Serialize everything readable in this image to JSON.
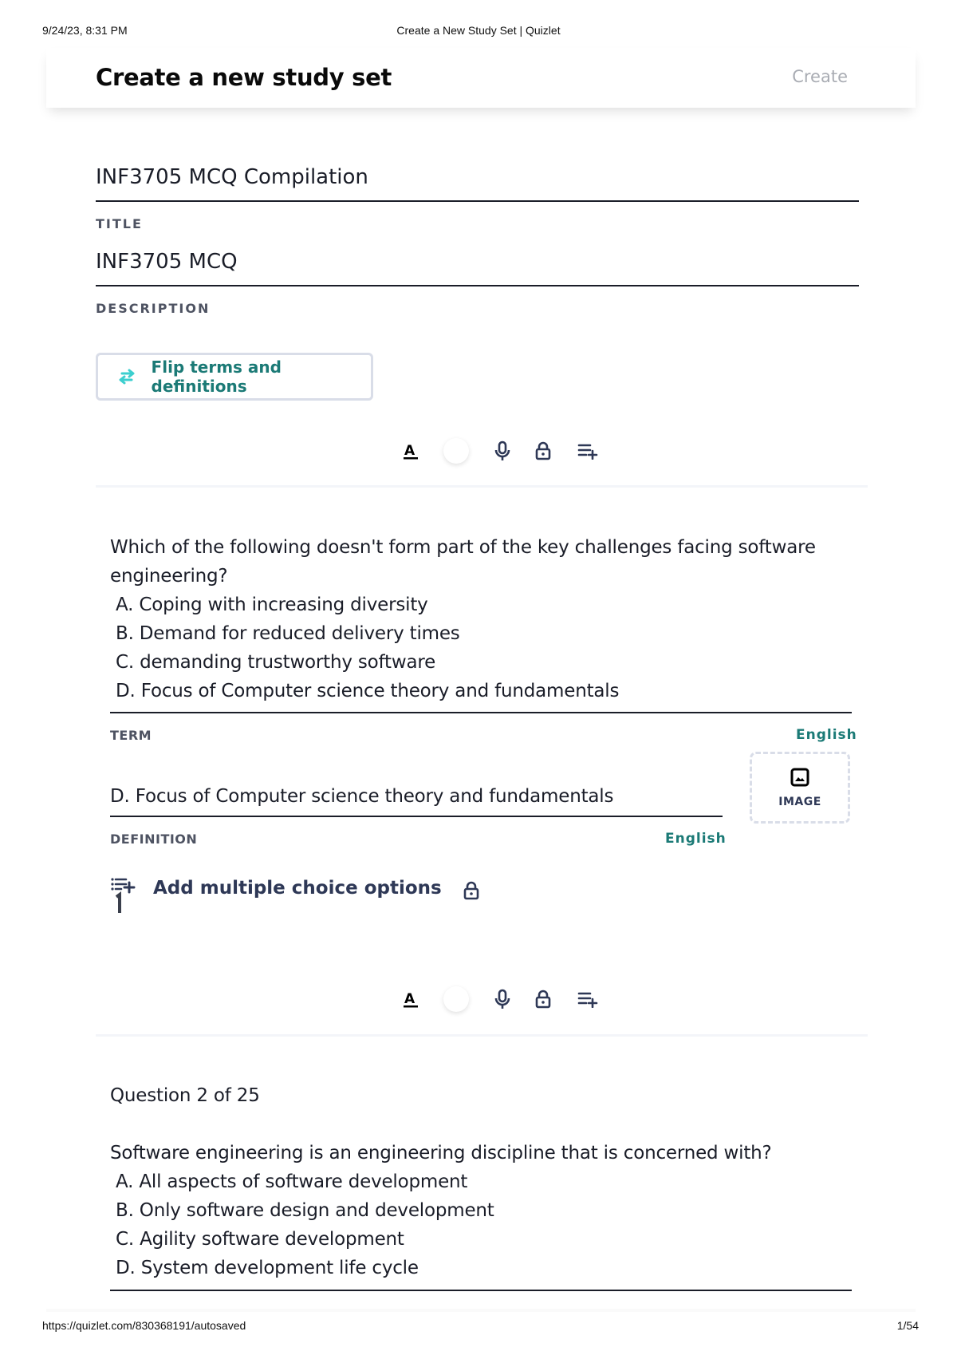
{
  "print_header": {
    "datetime": "9/24/23, 8:31 PM",
    "page_title": "Create a New Study Set | Quizlet"
  },
  "print_footer": {
    "url": "https://quizlet.com/830368191/autosaved",
    "page_count": "1/54"
  },
  "header": {
    "title": "Create a new study set",
    "create_label": "Create"
  },
  "set_fields": {
    "title_value": "INF3705 MCQ Compilation",
    "title_label": "TITLE",
    "description_value": "INF3705 MCQ",
    "description_label": "DESCRIPTION"
  },
  "flip_button": {
    "icon": "swap-arrows-icon",
    "label": "Flip terms and definitions"
  },
  "card_toolbar": {
    "icons": [
      "text-format-icon",
      "color-circle",
      "microphone-icon",
      "lock-icon",
      "add-list-icon"
    ]
  },
  "cards": [
    {
      "term_text": {
        "question": "Which of the following doesn't form part of the key challenges facing software engineering?",
        "options": [
          "A. Coping with increasing diversity",
          "B. Demand for reduced delivery times",
          "C. demanding trustworthy software",
          "D. Focus of Computer science theory and fundamentals"
        ]
      },
      "term_label": "TERM",
      "term_language": "English",
      "definition_value": "D. Focus of Computer science theory and fundamentals",
      "definition_label": "DEFINITION",
      "definition_language": "English",
      "image_label": "IMAGE",
      "multiple_choice_label": "Add multiple choice options"
    },
    {
      "term_text": {
        "header": "Question 2 of 25",
        "question": "Software engineering is an engineering discipline that is concerned with?",
        "options": [
          "A. All aspects of software development",
          "B. Only software design and development",
          "C. Agility software development",
          "D. System development life cycle"
        ]
      }
    }
  ],
  "colors": {
    "accent_teal": "#1b7a76",
    "flip_icon": "#3ccfcf",
    "navy_text": "#2e3856",
    "label_gray": "#4e5362",
    "disabled_gray": "#a9acb3",
    "border_light": "#d9dde8"
  }
}
